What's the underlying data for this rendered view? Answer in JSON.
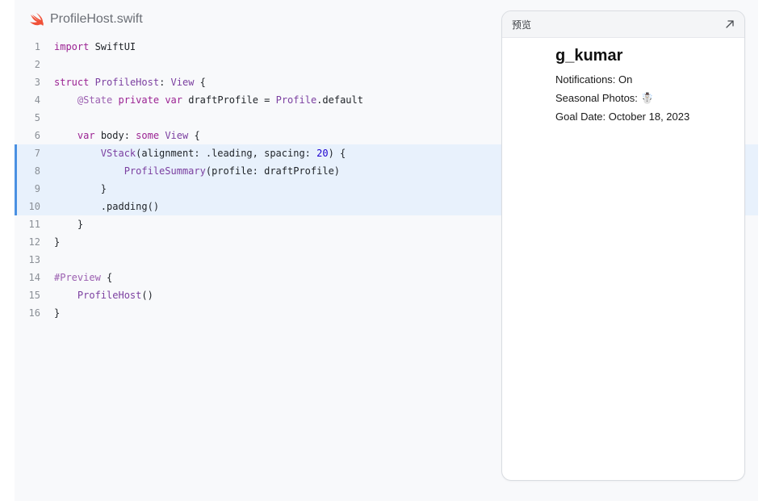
{
  "file": {
    "name": "ProfileHost.swift",
    "icon": "swift-logo-icon",
    "icon_color": "#f05138"
  },
  "code": {
    "highlight_color": "#e8f1fc",
    "highlight_bar_color": "#4a90e2",
    "highlighted_lines": [
      7,
      8,
      9,
      10
    ],
    "lines": [
      {
        "num": "1",
        "tokens": [
          {
            "c": "k",
            "t": "import"
          },
          {
            "c": "p",
            "t": " SwiftUI"
          }
        ]
      },
      {
        "num": "2",
        "tokens": []
      },
      {
        "num": "3",
        "tokens": [
          {
            "c": "k",
            "t": "struct"
          },
          {
            "c": "p",
            "t": " "
          },
          {
            "c": "t",
            "t": "ProfileHost"
          },
          {
            "c": "p",
            "t": ": "
          },
          {
            "c": "t",
            "t": "View"
          },
          {
            "c": "p",
            "t": " {"
          }
        ]
      },
      {
        "num": "4",
        "tokens": [
          {
            "c": "p",
            "t": "    "
          },
          {
            "c": "a",
            "t": "@State"
          },
          {
            "c": "p",
            "t": " "
          },
          {
            "c": "k",
            "t": "private"
          },
          {
            "c": "p",
            "t": " "
          },
          {
            "c": "k",
            "t": "var"
          },
          {
            "c": "p",
            "t": " draftProfile = "
          },
          {
            "c": "t",
            "t": "Profile"
          },
          {
            "c": "p",
            "t": ".default"
          }
        ]
      },
      {
        "num": "5",
        "tokens": []
      },
      {
        "num": "6",
        "tokens": [
          {
            "c": "p",
            "t": "    "
          },
          {
            "c": "k",
            "t": "var"
          },
          {
            "c": "p",
            "t": " body: "
          },
          {
            "c": "k",
            "t": "some"
          },
          {
            "c": "p",
            "t": " "
          },
          {
            "c": "t",
            "t": "View"
          },
          {
            "c": "p",
            "t": " {"
          }
        ]
      },
      {
        "num": "7",
        "tokens": [
          {
            "c": "p",
            "t": "        "
          },
          {
            "c": "t",
            "t": "VStack"
          },
          {
            "c": "p",
            "t": "(alignment: .leading, spacing: "
          },
          {
            "c": "n",
            "t": "20"
          },
          {
            "c": "p",
            "t": ") {"
          }
        ]
      },
      {
        "num": "8",
        "tokens": [
          {
            "c": "p",
            "t": "            "
          },
          {
            "c": "t",
            "t": "ProfileSummary"
          },
          {
            "c": "p",
            "t": "(profile: draftProfile)"
          }
        ]
      },
      {
        "num": "9",
        "tokens": [
          {
            "c": "p",
            "t": "        }"
          }
        ]
      },
      {
        "num": "10",
        "tokens": [
          {
            "c": "p",
            "t": "        .padding()"
          }
        ]
      },
      {
        "num": "11",
        "tokens": [
          {
            "c": "p",
            "t": "    }"
          }
        ]
      },
      {
        "num": "12",
        "tokens": [
          {
            "c": "p",
            "t": "}"
          }
        ]
      },
      {
        "num": "13",
        "tokens": []
      },
      {
        "num": "14",
        "tokens": [
          {
            "c": "a",
            "t": "#Preview"
          },
          {
            "c": "p",
            "t": " {"
          }
        ]
      },
      {
        "num": "15",
        "tokens": [
          {
            "c": "p",
            "t": "    "
          },
          {
            "c": "t",
            "t": "ProfileHost"
          },
          {
            "c": "p",
            "t": "()"
          }
        ]
      },
      {
        "num": "16",
        "tokens": [
          {
            "c": "p",
            "t": "}"
          }
        ]
      }
    ]
  },
  "preview": {
    "title": "预览",
    "expand_icon": "expand-arrow-icon",
    "username": "g_kumar",
    "notifications": "Notifications: On",
    "seasonal_photos": "Seasonal Photos: ☃️",
    "goal_date": "Goal Date: October 18, 2023"
  }
}
